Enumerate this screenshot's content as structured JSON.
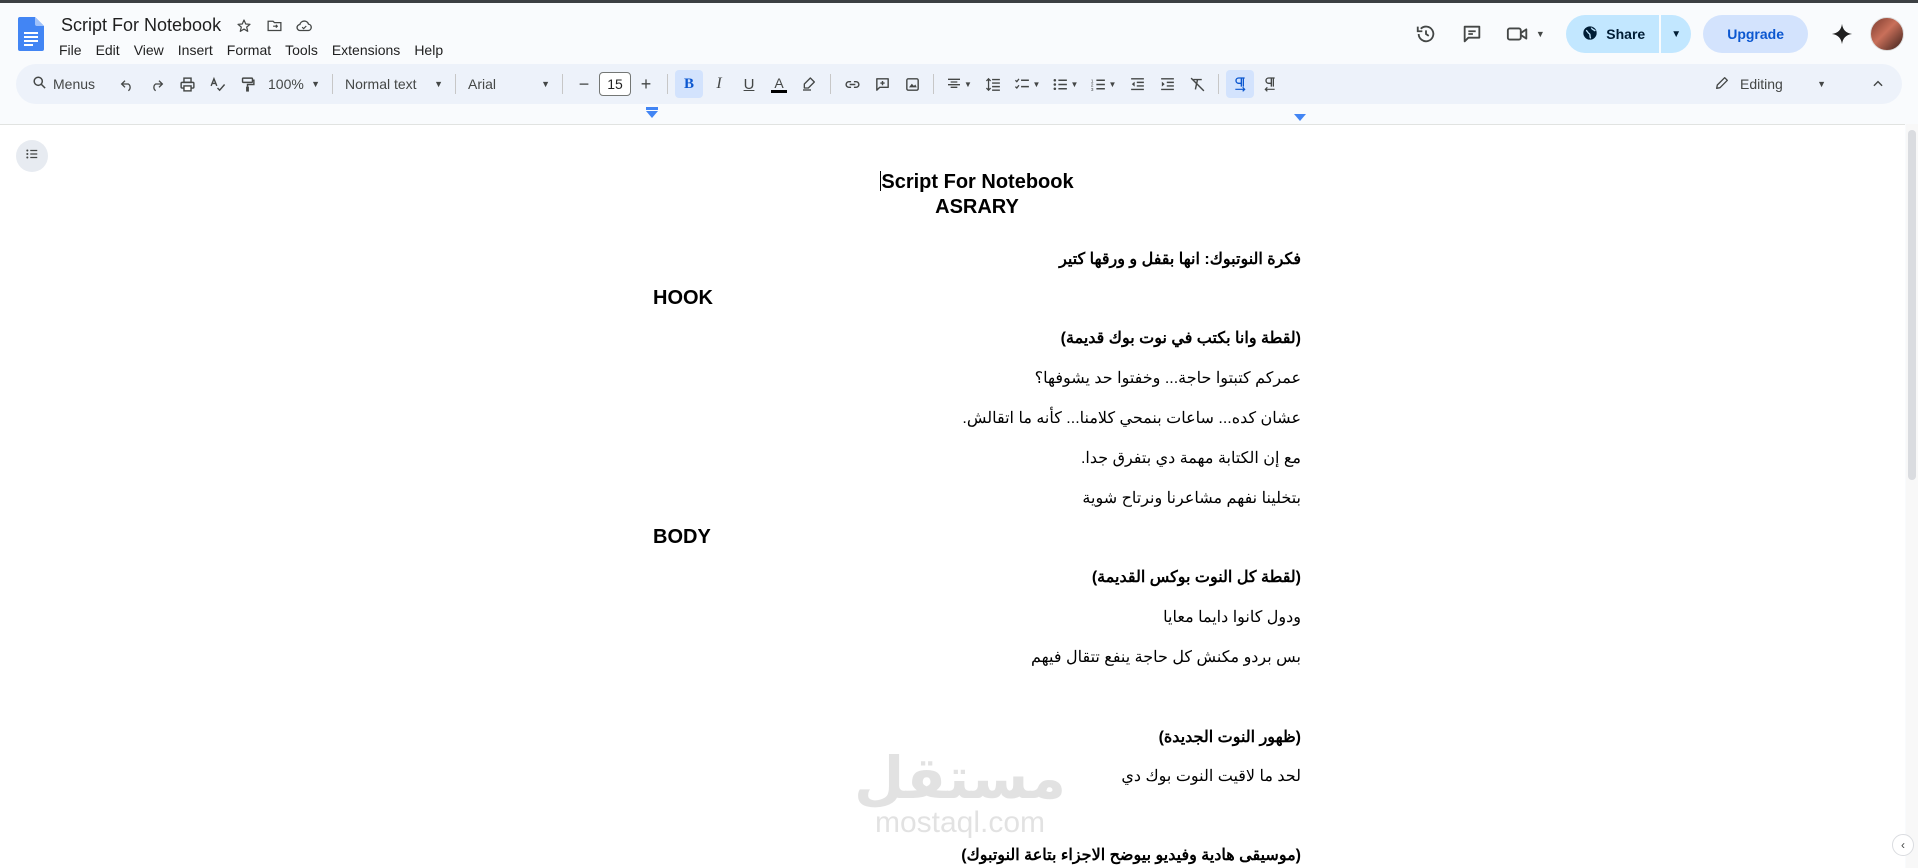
{
  "app": {
    "doc_title": "Script For Notebook",
    "menu": [
      "File",
      "Edit",
      "View",
      "Insert",
      "Format",
      "Tools",
      "Extensions",
      "Help"
    ]
  },
  "header": {
    "share_label": "Share",
    "upgrade_label": "Upgrade"
  },
  "toolbar": {
    "search_label": "Menus",
    "zoom": "100%",
    "style": "Normal text",
    "font": "Arial",
    "font_size": "15",
    "mode": "Editing"
  },
  "document": {
    "title": "Script For Notebook",
    "subtitle": "ASRARY",
    "idea": "فكرة النوتبوك: انها بقفل و ورقها كتير",
    "hook_heading": "HOOK",
    "hook_scene": "(لقطة وانا بكتب في نوت بوك قديمة)",
    "hook_line1": "عمركم كتبتوا حاجة... وخفتوا حد يشوفها؟",
    "hook_line2": "عشان كده... ساعات بنمحي كلامنا... كأنه ما اتقالش.",
    "hook_line3": "مع إن الكتابة مهمة دي بتفرق جدا.",
    "hook_line4": "بتخلينا نفهم مشاعرنا ونرتاح شوية",
    "body_heading": "BODY",
    "body_scene1": "(لقطة كل النوت بوكس القديمة)",
    "body_line1": "ودول كانوا دايما معايا",
    "body_line2": "بس بردو مكنش كل حاجة ينفع تتقال فيهم",
    "body_scene2": "(ظهور النوت الجديدة)",
    "body_line3": "لحد ما لاقيت النوت بوك دي",
    "body_scene3": "(موسيقى هادية وفيديو بيوضح الاجزاء بتاعة النوتبوك)"
  },
  "watermark": {
    "arabic": "مستقل",
    "latin": "mostaql.com"
  }
}
